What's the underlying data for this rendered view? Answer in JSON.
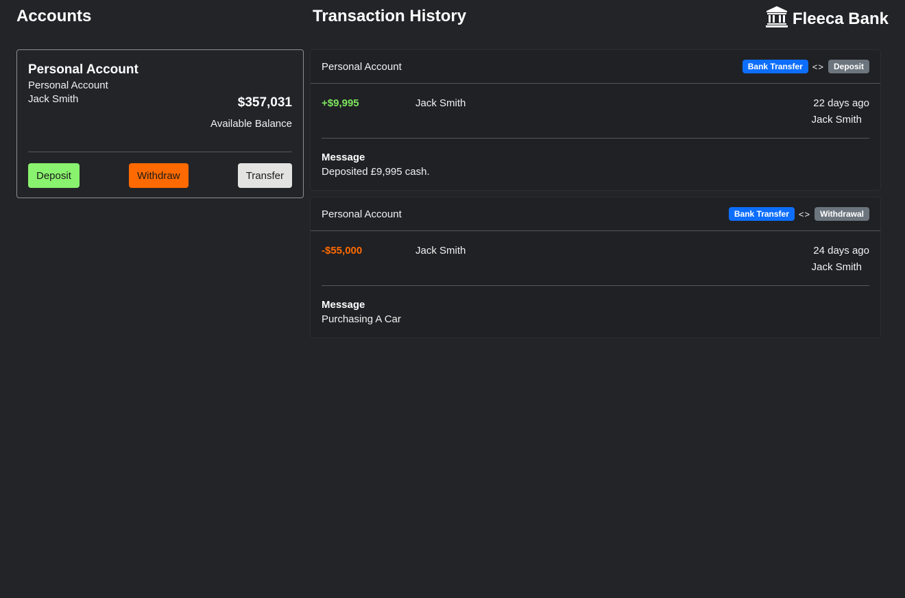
{
  "header": {
    "accounts_title": "Accounts",
    "history_title": "Transaction History",
    "brand_name": "Fleeca Bank",
    "brand_icon": "bank-building-icon"
  },
  "account": {
    "title": "Personal Account",
    "type": "Personal Account",
    "owner": "Jack Smith",
    "balance": "$357,031",
    "balance_label": "Available Balance",
    "buttons": {
      "deposit": "Deposit",
      "withdraw": "Withdraw",
      "transfer": "Transfer"
    }
  },
  "transactions": [
    {
      "account": "Personal Account",
      "method": "Bank Transfer",
      "arrows": "<>",
      "kind": "Deposit",
      "amount": "+$9,995",
      "party": "Jack Smith",
      "when": "22 days ago",
      "by": "Jack Smith",
      "message_label": "Message",
      "message": "Deposited £9,995 cash."
    },
    {
      "account": "Personal Account",
      "method": "Bank Transfer",
      "arrows": "<>",
      "kind": "Withdrawal",
      "amount": "-$55,000",
      "party": "Jack Smith",
      "when": "24 days ago",
      "by": "Jack Smith",
      "message_label": "Message",
      "message": "Purchasing A Car"
    }
  ],
  "colors": {
    "background": "#232428",
    "positive": "#7de65d",
    "negative": "#ff6a00",
    "deposit_button": "#89f26e",
    "withdraw_button": "#ff6a00",
    "transfer_button": "#e3e3e1",
    "badge_blue": "#0d6efd",
    "badge_grey": "#6c757d"
  }
}
